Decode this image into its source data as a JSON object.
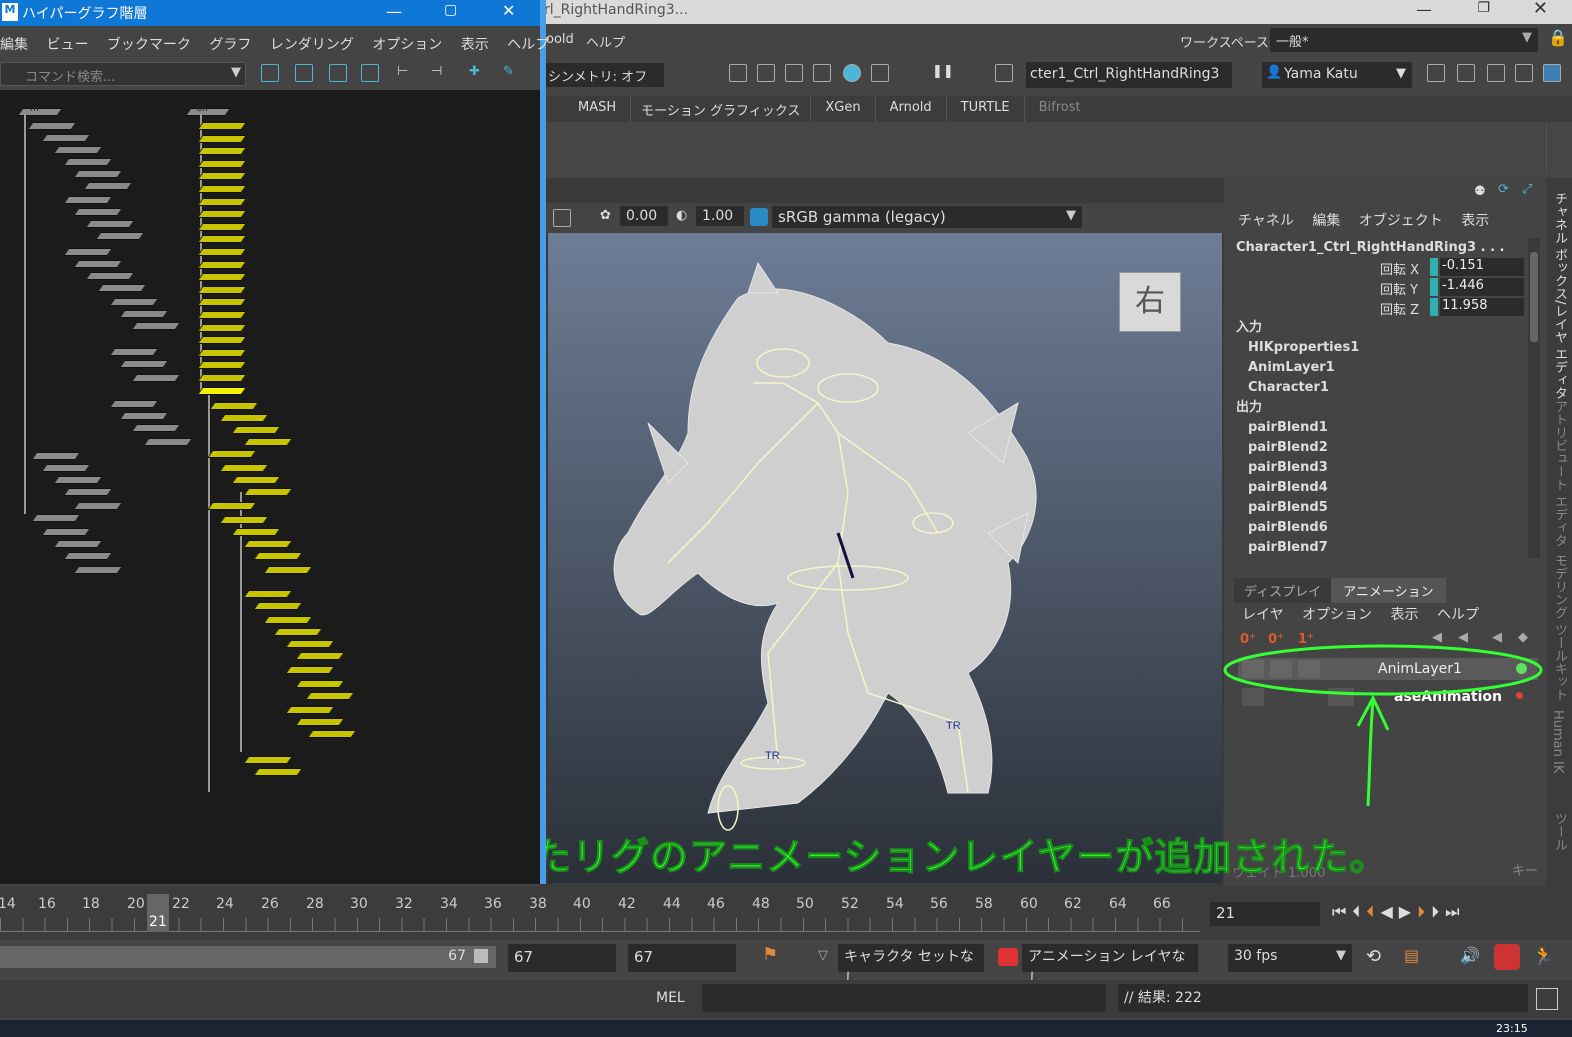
{
  "hypergraph": {
    "title": "ハイパーグラフ階層",
    "app_badge": "M",
    "menu": [
      "編集",
      "ビュー",
      "ブックマーク",
      "グラフ",
      "レンダリング",
      "オプション",
      "表示",
      "ヘルプ"
    ],
    "search_placeholder": "コマンド検索...",
    "root_node_gray": "m···",
    "root_node_yellow": "Ch···"
  },
  "main": {
    "title": "rl_RightHandRing3...",
    "menu_left": "oold",
    "menu_help": "ヘルプ",
    "workspace_label": "ワークスペース:",
    "workspace_value": "一般*",
    "symmetry": "シンメトリ: オフ",
    "object_field": "cter1_Ctrl_RightHandRing3",
    "user": "Yama Katu",
    "shelf_tabs": [
      "MASH",
      "モーション グラフィックス",
      "XGen",
      "Arnold",
      "TURTLE",
      "Bifrost"
    ]
  },
  "viewport": {
    "exposure": "0.00",
    "gamma": "1.00",
    "colorspace": "sRGB gamma (legacy)",
    "view_cube": "右",
    "annotation": "選択したリグのアニメーションレイヤーが追加された。",
    "tr_label": "TR"
  },
  "channel_box": {
    "menu": [
      "チャネル",
      "編集",
      "オブジェクト",
      "表示"
    ],
    "object": "Character1_Ctrl_RightHandRing3 . . .",
    "attrs": [
      {
        "name": "回転 X",
        "value": "-0.151"
      },
      {
        "name": "回転 Y",
        "value": "-1.446"
      },
      {
        "name": "回転 Z",
        "value": "11.958"
      }
    ],
    "inputs_label": "入力",
    "inputs": [
      "HIKproperties1",
      "AnimLayer1",
      "Character1"
    ],
    "outputs_label": "出力",
    "outputs": [
      "pairBlend1",
      "pairBlend2",
      "pairBlend3",
      "pairBlend4",
      "pairBlend5",
      "pairBlend6",
      "pairBlend7"
    ]
  },
  "layer_panel": {
    "tabs": [
      "ディスプレイ",
      "アニメーション"
    ],
    "menu": [
      "レイヤ",
      "オプション",
      "表示",
      "ヘルプ"
    ],
    "layers": [
      "AnimLayer1",
      "aseAnimation"
    ],
    "weight_label": "ウェイト 1.000",
    "key_label": "キー"
  },
  "side_tabs": [
    "チャネル ボックス/レイヤ エディタ",
    "アトリビュート エディタ",
    "モデリング ツールキット",
    "Human IK",
    "ツール"
  ],
  "timeline": {
    "ticks": [
      "14",
      "16",
      "18",
      "20",
      "22",
      "24",
      "26",
      "28",
      "30",
      "32",
      "34",
      "36",
      "38",
      "40",
      "42",
      "44",
      "46",
      "48",
      "50",
      "52",
      "54",
      "56",
      "58",
      "60",
      "62",
      "64",
      "66"
    ],
    "current": "21",
    "frame_field": "21"
  },
  "range": {
    "end_slider": "67",
    "field1": "67",
    "field2": "67",
    "character_set": "キャラクタ セットなし",
    "anim_layer": "アニメーション レイヤなし",
    "fps": "30 fps"
  },
  "cmdline": {
    "mode": "MEL",
    "result": "// 結果: 222"
  },
  "taskbar": {
    "clock": "23:15"
  },
  "colors": {
    "accent": "#0f78d7",
    "annotation": "#33ff33",
    "yellow_node": "#c8c400",
    "gray_node": "#8a8a8a"
  }
}
